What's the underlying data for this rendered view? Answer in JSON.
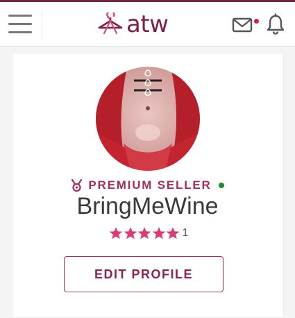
{
  "header": {
    "logo_text": "atw",
    "menu_icon": "hamburger-menu-icon",
    "mail_icon": "mail-icon",
    "bell_icon": "bell-icon",
    "has_unread_mail": true
  },
  "profile": {
    "badge_icon": "medal-icon",
    "badge_label": "PREMIUM SELLER",
    "online": true,
    "username": "BringMeWine",
    "rating_stars": 5,
    "rating_count": "1",
    "edit_button_label": "EDIT PROFILE"
  },
  "colors": {
    "brand": "#7a1f45",
    "accent": "#a0305a",
    "star": "#d93c73",
    "online": "#1c8a2c",
    "notification": "#d61f3d"
  }
}
